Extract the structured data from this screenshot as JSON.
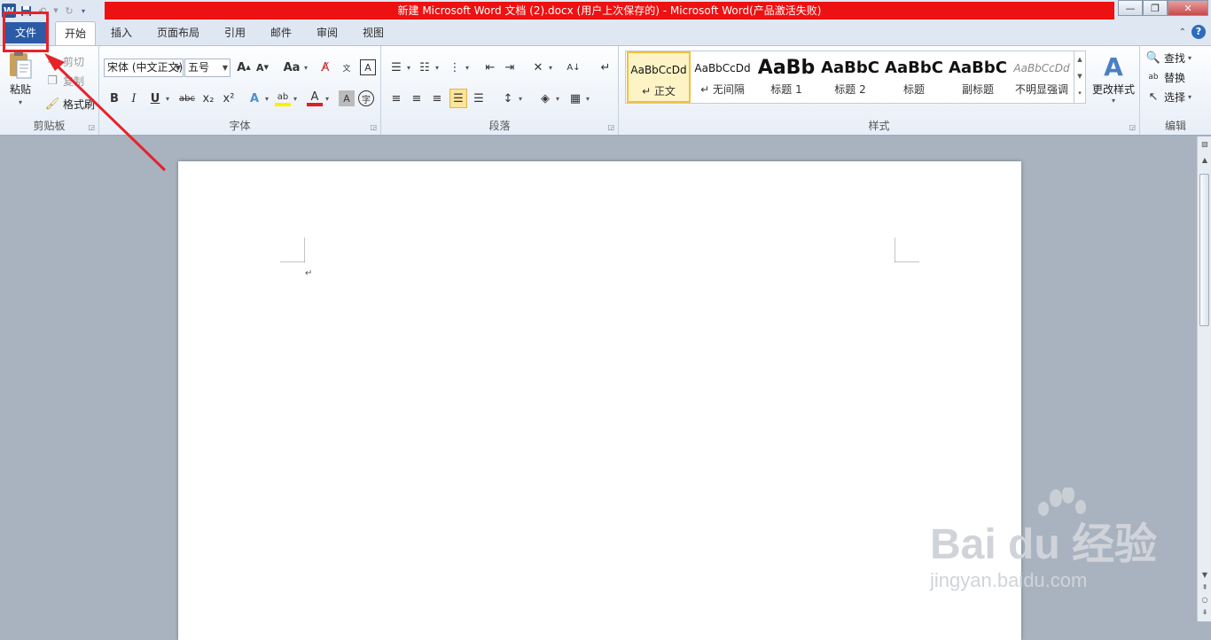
{
  "window": {
    "title": "新建 Microsoft Word 文档 (2).docx (用户上次保存的)  -  Microsoft Word(产品激活失败)",
    "title_bar_color": "#ee1111",
    "minimize": "—",
    "maximize": "❐",
    "close": "✕"
  },
  "qat": {
    "logo": "W",
    "icons": [
      "save-icon",
      "undo-icon",
      "redo-icon",
      "customize-icon"
    ]
  },
  "tabs": {
    "file": "文件",
    "home": "开始",
    "insert": "插入",
    "layout": "页面布局",
    "references": "引用",
    "mailings": "邮件",
    "review": "审阅",
    "view": "视图"
  },
  "help": "?",
  "ribbon": {
    "clipboard": {
      "label": "剪贴板",
      "paste": "粘贴",
      "cut": "剪切",
      "copy": "复制",
      "format_painter": "格式刷"
    },
    "font": {
      "label": "字体",
      "font_name": "宋体 (中文正文)",
      "font_size": "五号",
      "grow": "A",
      "shrink": "A",
      "change_case": "Aa",
      "bold": "B",
      "italic": "I",
      "underline": "U",
      "strike": "abc",
      "subscript": "x₂",
      "superscript": "x²",
      "font_color_letter": "A",
      "highlight": "ab",
      "char_border": "A",
      "enclosed": "字",
      "phonetic": "wén",
      "clear": "A"
    },
    "paragraph": {
      "label": "段落"
    },
    "styles": {
      "label": "样式",
      "items": [
        {
          "preview": "AaBbCcDd",
          "name": "↵ 正文",
          "selected": true
        },
        {
          "preview": "AaBbCcDd",
          "name": "↵ 无间隔"
        },
        {
          "preview": "AaBb",
          "name": "标题 1"
        },
        {
          "preview": "AaBbC",
          "name": "标题 2"
        },
        {
          "preview": "AaBbC",
          "name": "标题"
        },
        {
          "preview": "AaBbC",
          "name": "副标题"
        },
        {
          "preview": "AaBbCcDd",
          "name": "不明显强调"
        }
      ],
      "change_styles": "更改样式"
    },
    "editing": {
      "label": "编辑",
      "find": "查找",
      "replace": "替换",
      "select": "选择"
    }
  },
  "document": {
    "paragraph_mark": "↵"
  },
  "watermark": {
    "brand": "Bai du 经验",
    "url": "jingyan.baidu.com"
  },
  "annotation": {
    "color": "#e6232a"
  }
}
